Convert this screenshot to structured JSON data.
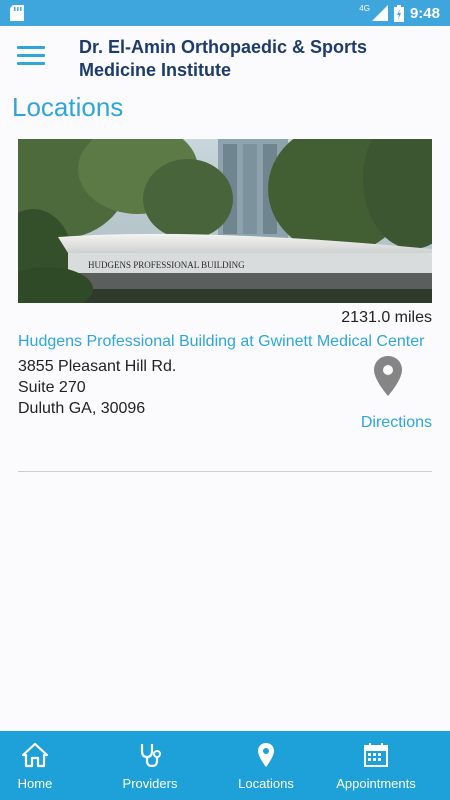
{
  "status_bar": {
    "network": "4G",
    "time": "9:48"
  },
  "header": {
    "title": "Dr. El-Amin Orthopaedic & Sports Medicine Institute"
  },
  "page": {
    "title": "Locations"
  },
  "location": {
    "photo_sign": "HUDGENS PROFESSIONAL BUILDING",
    "distance": "2131.0 miles",
    "name": "Hudgens Professional Building at Gwinett Medical Center",
    "address_line1": "3855 Pleasant Hill Rd.",
    "address_line2": "Suite 270",
    "address_line3": "Duluth GA, 30096",
    "directions_label": "Directions",
    "icon": "map-pin-icon"
  },
  "bottom_nav": {
    "items": [
      {
        "label": "Home",
        "icon": "home-icon"
      },
      {
        "label": "Providers",
        "icon": "stethoscope-icon"
      },
      {
        "label": "Locations",
        "icon": "map-pin-icon"
      },
      {
        "label": "Appointments",
        "icon": "calendar-icon"
      }
    ]
  },
  "colors": {
    "accent": "#2ea6d9",
    "status_bar": "#3ea6dc",
    "bottom_nav": "#1ea0d8",
    "title_text": "#1d3c6a"
  }
}
